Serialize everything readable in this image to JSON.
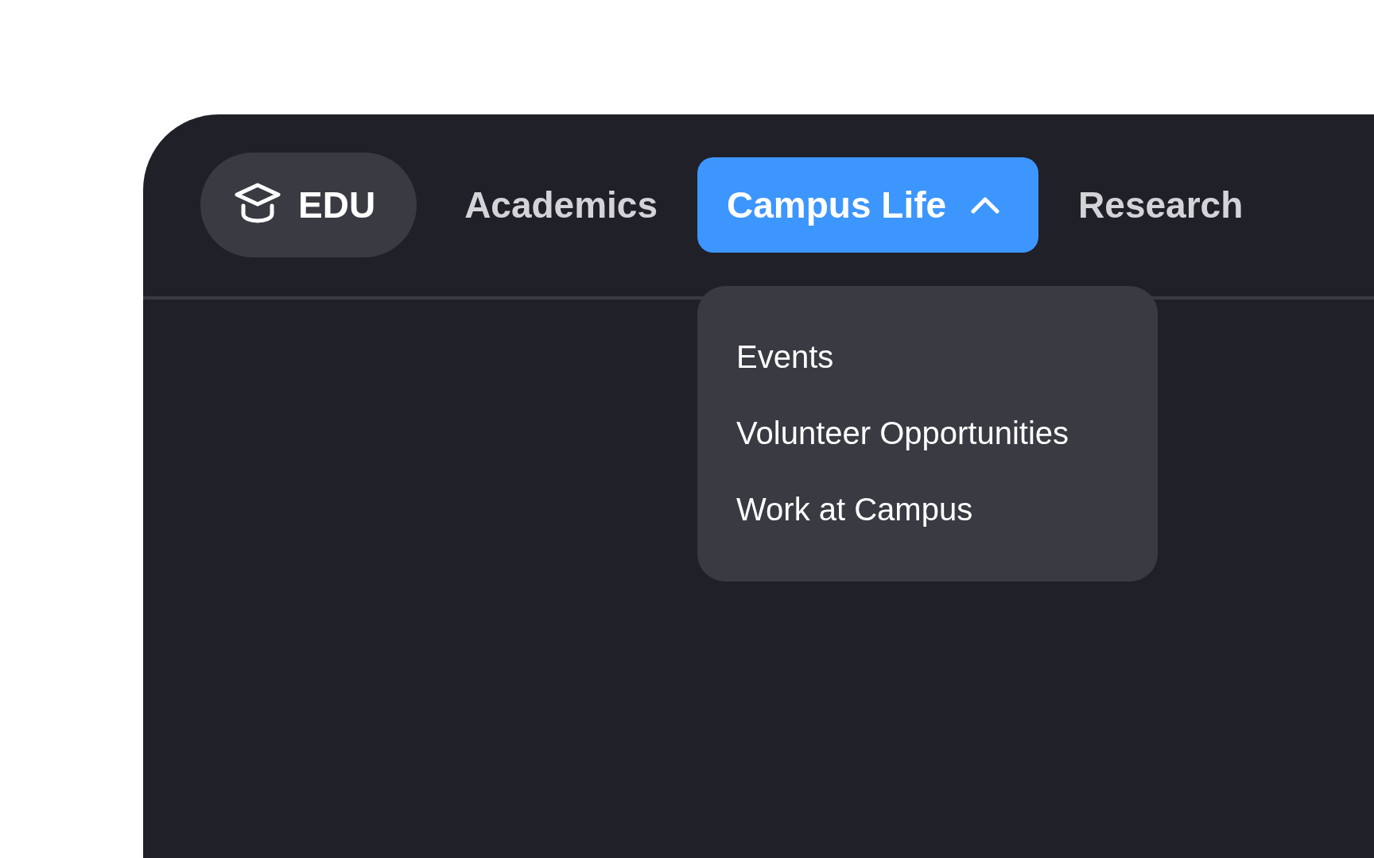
{
  "logo": {
    "text": "EDU"
  },
  "nav": [
    {
      "label": "Academics",
      "selected": false
    },
    {
      "label": "Campus Life",
      "selected": true,
      "expanded": true,
      "menu": [
        "Events",
        "Volunteer Opportunities",
        "Work at Campus"
      ]
    },
    {
      "label": "Research",
      "selected": false
    }
  ]
}
